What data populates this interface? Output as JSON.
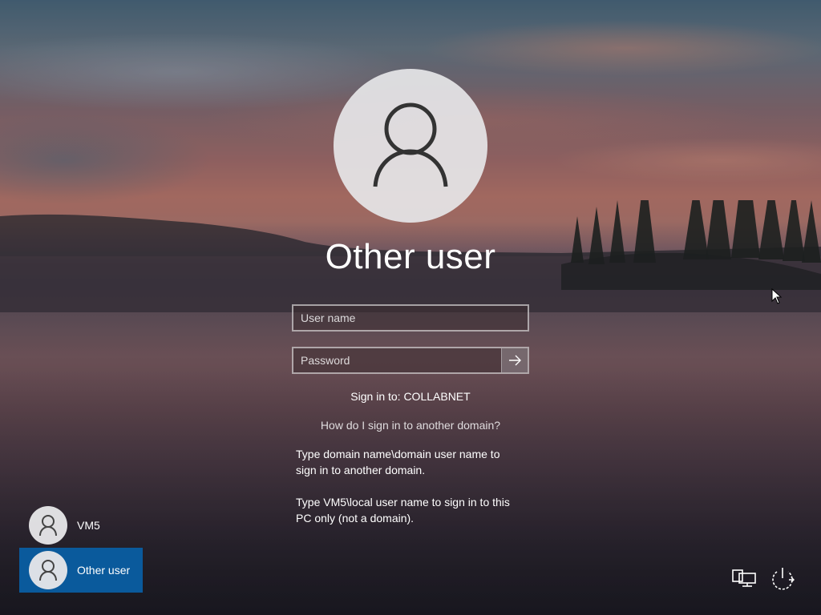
{
  "screen": "Windows sign-in",
  "user": {
    "display_name": "Other user"
  },
  "form": {
    "username_placeholder": "User name",
    "password_placeholder": "Password",
    "submit_icon": "arrow-right-icon"
  },
  "sign_in_to": "Sign in to: COLLABNET",
  "help_link": "How do I sign in to another domain?",
  "help_text": {
    "line1a": "Type domain name\\domain user name to",
    "line1b": "sign in to another domain.",
    "line2a": "Type VM5\\local user name to sign in to this",
    "line2b": "PC only (not a domain)."
  },
  "user_list": [
    {
      "name": "VM5",
      "selected": false
    },
    {
      "name": "Other user",
      "selected": true
    }
  ],
  "system_icons": [
    "network-icon",
    "power-icon"
  ],
  "colors": {
    "selected_tile": "#0a5a9c"
  }
}
